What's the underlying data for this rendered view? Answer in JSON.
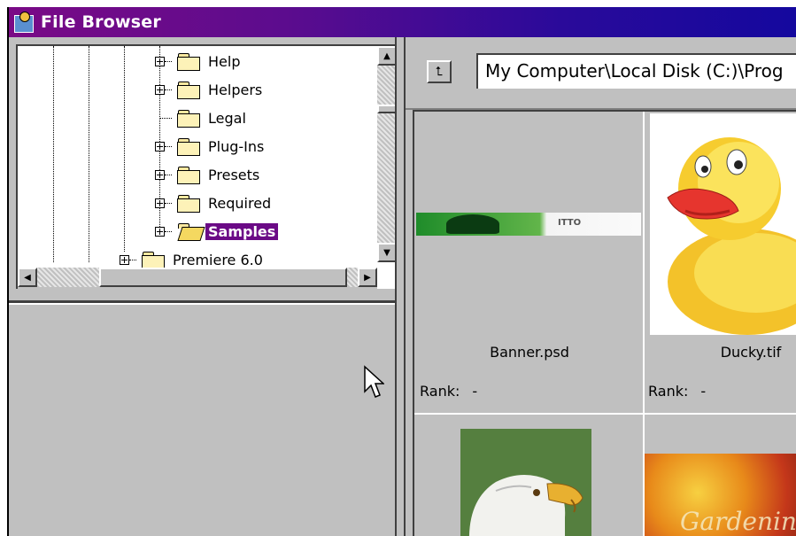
{
  "window": {
    "title": "File Browser",
    "title_gradient": [
      "#7a0a86",
      "#14089e"
    ]
  },
  "tree": {
    "items": [
      {
        "label": "Help",
        "expandable": true,
        "selected": false
      },
      {
        "label": "Helpers",
        "expandable": true,
        "selected": false
      },
      {
        "label": "Legal",
        "expandable": false,
        "selected": false
      },
      {
        "label": "Plug-Ins",
        "expandable": true,
        "selected": false
      },
      {
        "label": "Presets",
        "expandable": true,
        "selected": false
      },
      {
        "label": "Required",
        "expandable": true,
        "selected": false
      },
      {
        "label": "Samples",
        "expandable": true,
        "selected": true
      },
      {
        "label": "Premiere 6.0",
        "expandable": true,
        "selected": false
      }
    ],
    "selected_color": "#6b0a86"
  },
  "pathbar": {
    "up_icon": "folder-up-icon",
    "path": "My Computer\\Local Disk (C:)\\Prog"
  },
  "thumbnails": [
    {
      "name": "Banner.psd",
      "rank_label": "Rank:",
      "rank_value": "-"
    },
    {
      "name": "Ducky.tif",
      "rank_label": "Rank:",
      "rank_value": "-"
    }
  ],
  "flower_caption": "Gardening C"
}
